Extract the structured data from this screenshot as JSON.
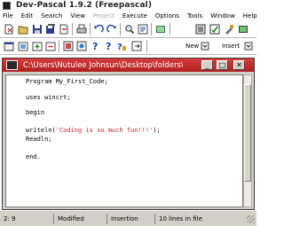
{
  "app": {
    "title": "Dev-Pascal 1.9.2 (Freepascal)"
  },
  "menu": {
    "items": [
      {
        "label": "File",
        "enabled": true
      },
      {
        "label": "Edit",
        "enabled": true
      },
      {
        "label": "Search",
        "enabled": true
      },
      {
        "label": "View",
        "enabled": true
      },
      {
        "label": "Project",
        "enabled": false
      },
      {
        "label": "Execute",
        "enabled": true
      },
      {
        "label": "Options",
        "enabled": true
      },
      {
        "label": "Tools",
        "enabled": true
      },
      {
        "label": "Window",
        "enabled": true
      },
      {
        "label": "Help",
        "enabled": true
      }
    ]
  },
  "toolbar2": {
    "new_label": "New",
    "insert_label": "Insert"
  },
  "editor_window": {
    "title": "C:\\Users\\Nutulee Johnsun\\Desktop\\folders\\GI...",
    "colors": {
      "title_bar": "#c62d2d",
      "string": "#c82828"
    },
    "code": [
      {
        "text": "Program My_First_Code;"
      },
      {
        "text": "uses wincrt;"
      },
      {
        "text": "begin"
      },
      {
        "pre": "writeln(",
        "str": "'Coding is so much fun!!!'",
        "post": ");"
      },
      {
        "text": "Readln;"
      },
      {
        "text": "end."
      }
    ]
  },
  "statusbar": {
    "position": "2: 9",
    "modified": "Modified",
    "mode": "Insertion",
    "lines": "10 lines in file"
  }
}
